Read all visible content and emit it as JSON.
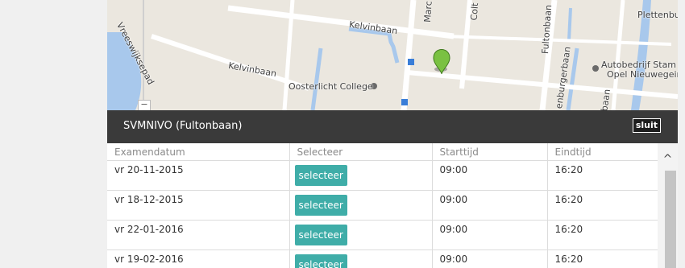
{
  "map": {
    "labels": {
      "kelvinbaan_top": "Kelvinbaan",
      "kelvinbaan_left": "Kelvinbaan",
      "vreeswijk": "Vreeswijksepad",
      "marconi": "Marc",
      "colt": "Colt",
      "fultonbaan": "Fultonbaan",
      "plettenburg": "Plettenbu",
      "oosterlicht": "Oosterlicht College",
      "burgerbaan": "enburgerbaan",
      "autobedrijf_line1": "Autobedrijf Stam",
      "autobedrijf_line2": "Opel Nieuwegein",
      "baan": "baan"
    },
    "zoom_out_label": "−",
    "colors": {
      "water": "#a8c8ec",
      "road": "#ffffff",
      "marker": "#7ac142"
    }
  },
  "modal": {
    "title": "SVMNIVO (Fultonbaan)",
    "close_label": "sluit",
    "header_bg": "#3a3a3a"
  },
  "table": {
    "headers": [
      "Examendatum",
      "Selecteer",
      "Starttijd",
      "Eindtijd"
    ],
    "rows": [
      {
        "date": "vr 20-11-2015",
        "button": "selecteer",
        "start": "09:00",
        "end": "16:20"
      },
      {
        "date": "vr 18-12-2015",
        "button": "selecteer",
        "start": "09:00",
        "end": "16:20"
      },
      {
        "date": "vr 22-01-2016",
        "button": "selecteer",
        "start": "09:00",
        "end": "16:20"
      },
      {
        "date": "vr 19-02-2016",
        "button": "selecteer",
        "start": "09:00",
        "end": "16:20"
      }
    ],
    "button_color": "#3fada8"
  },
  "scrollbar": {
    "up_arrow": "^"
  }
}
